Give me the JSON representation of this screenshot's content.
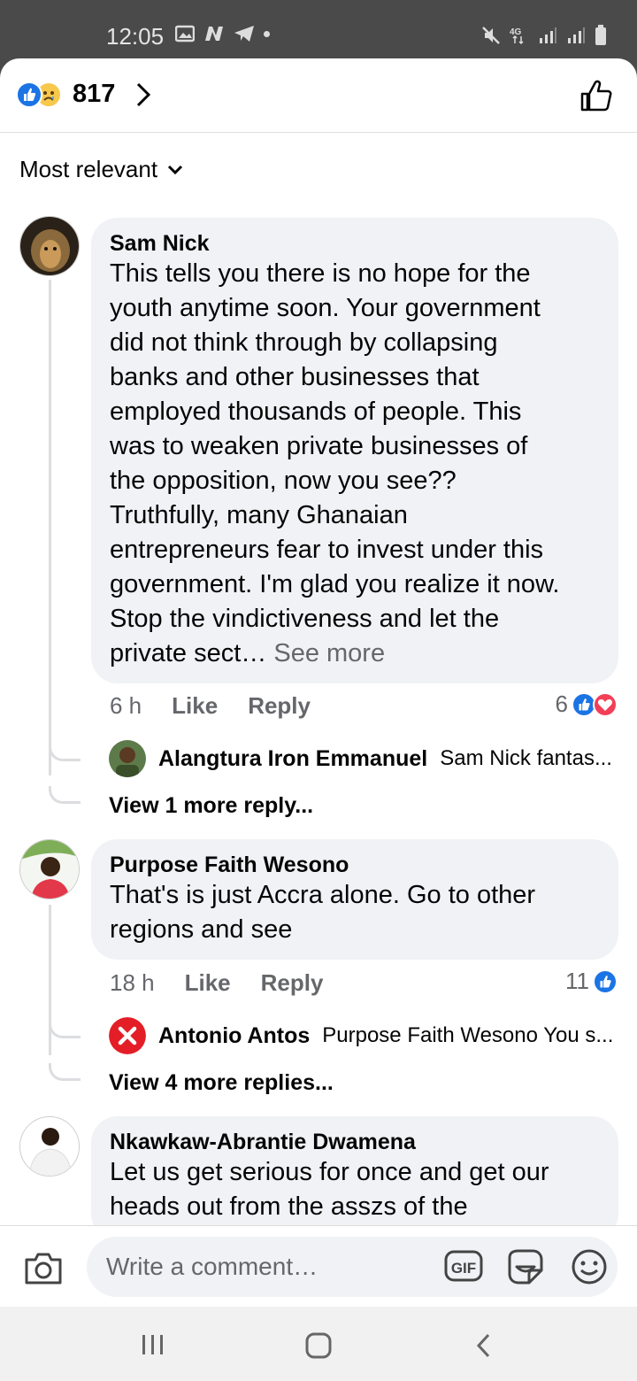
{
  "status_bar": {
    "time": "12:05",
    "network": "4G"
  },
  "reactions_header": {
    "count": "817",
    "icons": [
      "like-icon",
      "sad-icon",
      "chevron-right-icon",
      "thumbs-up-icon"
    ]
  },
  "sort": {
    "label": "Most relevant"
  },
  "comments": [
    {
      "name": "Sam Nick",
      "lines": [
        "This tells you there is no hope for the",
        "youth anytime soon. Your government",
        "did not think through by collapsing",
        "banks and other businesses that",
        "employed thousands of people. This",
        "was to weaken private businesses of",
        "the opposition, now you see??",
        "Truthfully, many Ghanaian",
        "entrepreneurs fear to invest under this",
        "government. I'm glad you realize it now.",
        "Stop the vindictiveness and let the",
        "private sect…"
      ],
      "see_more": "See more",
      "time": "6 h",
      "like": "Like",
      "reply": "Reply",
      "reaction_count": "6",
      "reply_preview": {
        "name": "Alangtura Iron Emmanuel",
        "text": "Sam Nick fantas..."
      },
      "view_more": "View 1 more reply..."
    },
    {
      "name": "Purpose Faith Wesono",
      "lines": [
        "That's is just Accra alone. Go to other",
        "regions and see"
      ],
      "time": "18 h",
      "like": "Like",
      "reply": "Reply",
      "reaction_count": "11",
      "reply_preview": {
        "name": "Antonio Antos",
        "text": "Purpose Faith Wesono You s..."
      },
      "view_more": "View 4 more replies..."
    },
    {
      "name": "Nkawkaw-Abrantie Dwamena",
      "lines": [
        "Let us get serious for once and get our",
        "heads out from the asszs of the"
      ]
    }
  ],
  "composer": {
    "placeholder": "Write a comment…",
    "gif_label": "GIF"
  },
  "colors": {
    "accent": "#1b74e4",
    "bubble": "#f0f2f5",
    "muted": "#65676b",
    "love": "#f33e58"
  }
}
